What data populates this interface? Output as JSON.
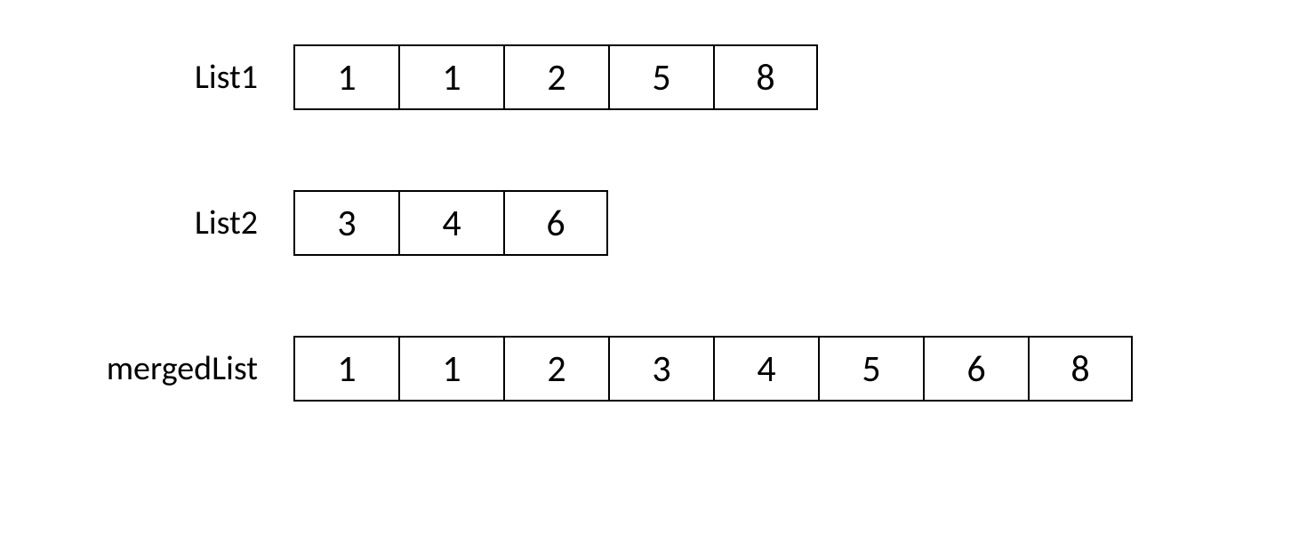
{
  "lists": [
    {
      "label": "List1",
      "values": [
        1,
        1,
        2,
        5,
        8
      ]
    },
    {
      "label": "List2",
      "values": [
        3,
        4,
        6
      ]
    },
    {
      "label": "mergedList",
      "values": [
        1,
        1,
        2,
        3,
        4,
        5,
        6,
        8
      ]
    }
  ]
}
